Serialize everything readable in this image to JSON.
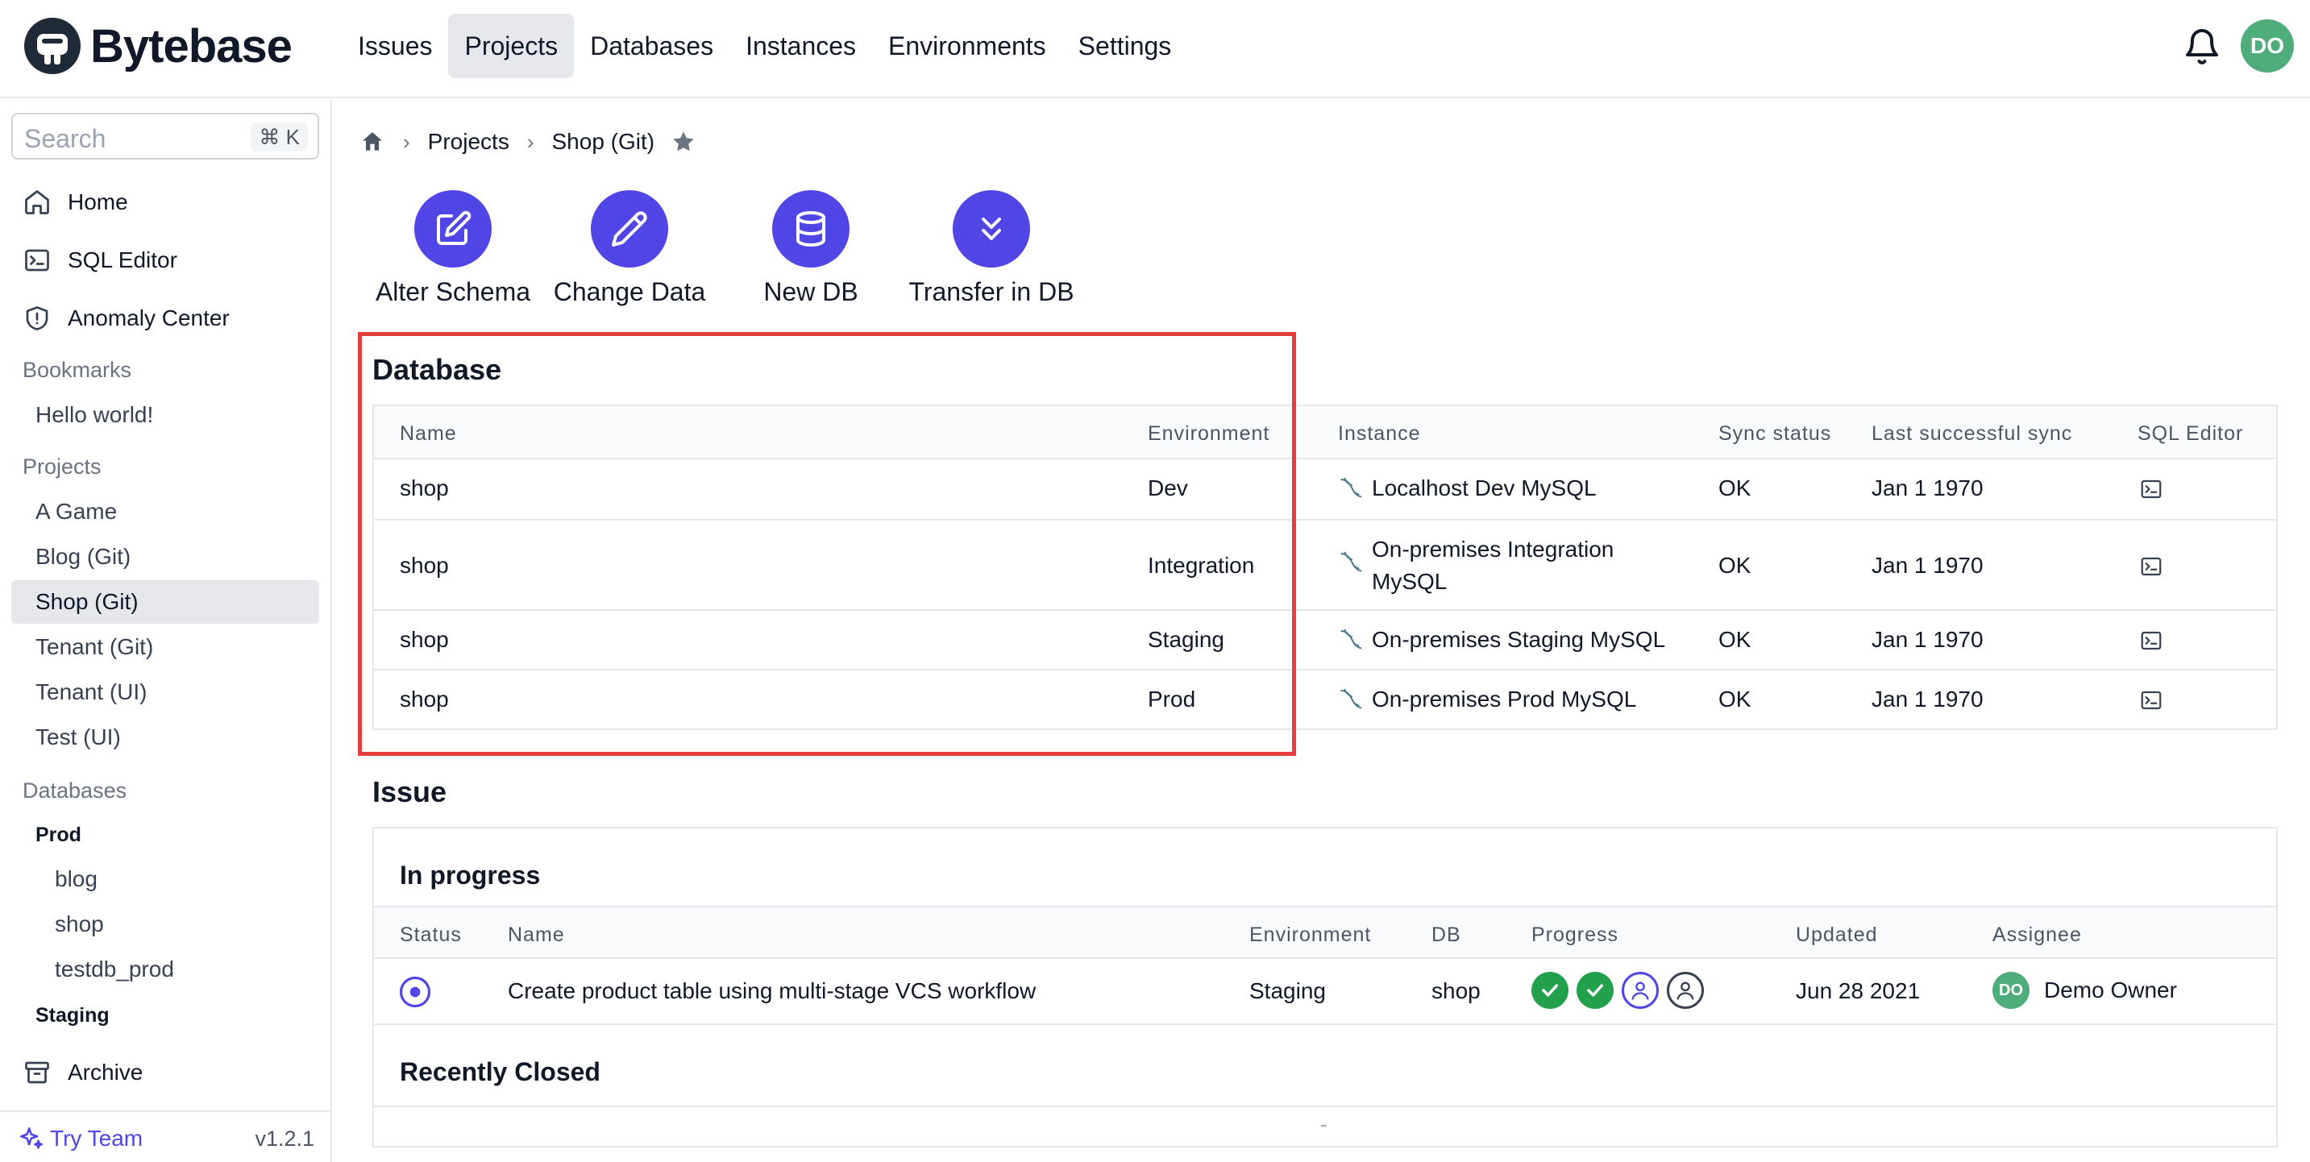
{
  "header": {
    "brand": "Bytebase",
    "nav": [
      "Issues",
      "Projects",
      "Databases",
      "Instances",
      "Environments",
      "Settings"
    ],
    "active_nav": "Projects",
    "avatar_initials": "DO"
  },
  "sidebar": {
    "search_placeholder": "Search",
    "search_shortcut": "⌘ K",
    "main_items": [
      "Home",
      "SQL Editor",
      "Anomaly Center"
    ],
    "bookmarks_heading": "Bookmarks",
    "bookmarks": [
      "Hello world!"
    ],
    "projects_heading": "Projects",
    "projects": [
      "A Game",
      "Blog (Git)",
      "Shop (Git)",
      "Tenant (Git)",
      "Tenant (UI)",
      "Test (UI)"
    ],
    "active_project": "Shop (Git)",
    "databases_heading": "Databases",
    "db_groups": [
      {
        "env": "Prod",
        "dbs": [
          "blog",
          "shop",
          "testdb_prod"
        ]
      },
      {
        "env": "Staging",
        "dbs": []
      }
    ],
    "archive": "Archive",
    "try_team": "Try Team",
    "version": "v1.2.1"
  },
  "breadcrumb": {
    "projects": "Projects",
    "current": "Shop (Git)"
  },
  "quick_actions": [
    "Alter Schema",
    "Change Data",
    "New DB",
    "Transfer in DB"
  ],
  "database": {
    "title": "Database",
    "columns": [
      "Name",
      "Environment",
      "Instance",
      "Sync status",
      "Last successful sync",
      "SQL Editor"
    ],
    "rows": [
      {
        "name": "shop",
        "environment": "Dev",
        "instance": "Localhost Dev MySQL",
        "sync": "OK",
        "last_sync": "Jan 1 1970"
      },
      {
        "name": "shop",
        "environment": "Integration",
        "instance": "On-premises Integration MySQL",
        "sync": "OK",
        "last_sync": "Jan 1 1970"
      },
      {
        "name": "shop",
        "environment": "Staging",
        "instance": "On-premises Staging MySQL",
        "sync": "OK",
        "last_sync": "Jan 1 1970"
      },
      {
        "name": "shop",
        "environment": "Prod",
        "instance": "On-premises Prod MySQL",
        "sync": "OK",
        "last_sync": "Jan 1 1970"
      }
    ]
  },
  "issue": {
    "title": "Issue",
    "in_progress_title": "In progress",
    "columns": [
      "Status",
      "Name",
      "Environment",
      "DB",
      "Progress",
      "Updated",
      "Assignee"
    ],
    "rows": [
      {
        "name": "Create product table using multi-stage VCS workflow",
        "environment": "Staging",
        "db": "shop",
        "progress": [
          "done",
          "done",
          "current",
          "pending"
        ],
        "updated": "Jun 28 2021",
        "assignee": "Demo Owner",
        "assignee_initials": "DO"
      }
    ],
    "recently_closed_title": "Recently Closed",
    "recently_closed_empty": "-"
  },
  "colors": {
    "accent": "#4f46e5",
    "success": "#22a04b",
    "highlight": "#e53e3e",
    "avatar": "#4ead7a"
  }
}
